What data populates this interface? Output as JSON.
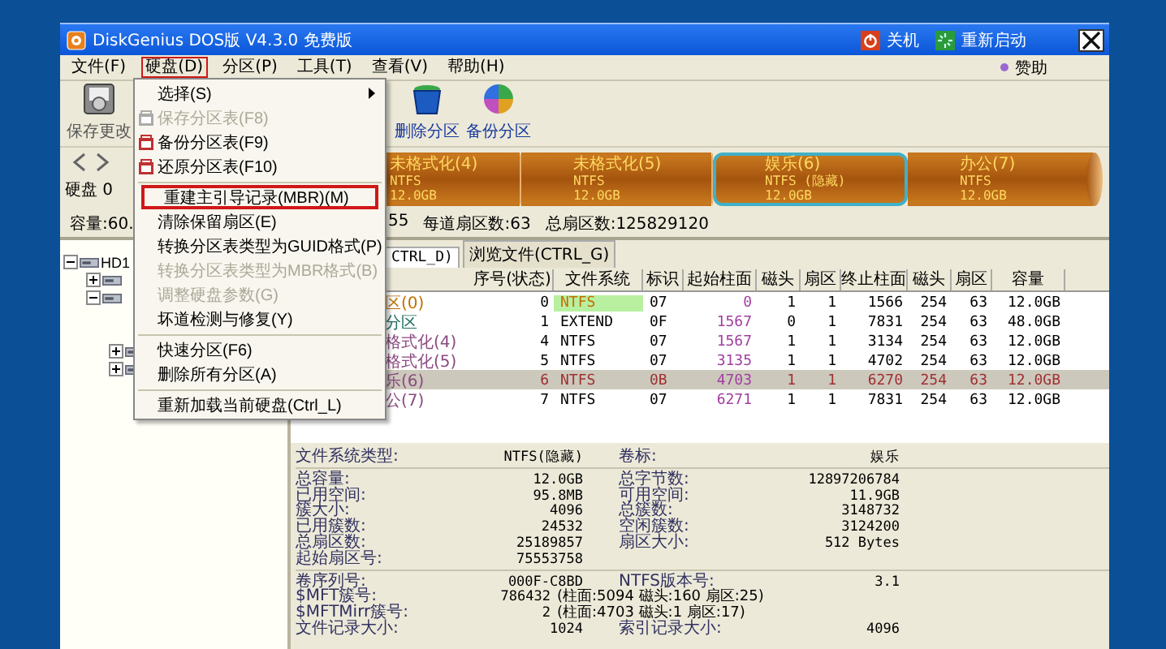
{
  "window": {
    "title": "DiskGenius DOS版 V4.3.0 免费版",
    "title_buttons": [
      {
        "kind": "shutdown",
        "label": "关机"
      },
      {
        "kind": "restart",
        "label": "重新启动"
      }
    ]
  },
  "menu_bar": {
    "items": [
      {
        "label": "文件(F)",
        "selected": false
      },
      {
        "label": "硬盘(D)",
        "selected": true
      },
      {
        "label": "分区(P)",
        "selected": false
      },
      {
        "label": "工具(T)",
        "selected": false
      },
      {
        "label": "查看(V)",
        "selected": false
      },
      {
        "label": "帮助(H)",
        "selected": false
      }
    ],
    "sponsor": "赞助"
  },
  "toolbar": {
    "buttons": [
      {
        "kind": "save",
        "label": "保存更改"
      },
      {
        "kind": "delete",
        "label": "删除分区"
      },
      {
        "kind": "backup",
        "label": "备份分区"
      }
    ]
  },
  "disk_nav": {
    "label": "硬盘 0"
  },
  "partition_bar": [
    {
      "name": "未格式化(4)",
      "fs": "NTFS",
      "size": "12.0GB",
      "selected": false
    },
    {
      "name": "未格式化(5)",
      "fs": "NTFS",
      "size": "12.0GB",
      "selected": false
    },
    {
      "name": "娱乐(6)",
      "fs": "NTFS (隐藏)",
      "size": "12.0GB",
      "selected": true
    },
    {
      "name": "办公(7)",
      "fs": "NTFS",
      "size": "12.0GB",
      "selected": false
    }
  ],
  "disk_info": {
    "left": "容量:60.",
    "parts": [
      "55",
      "每道扇区数:63",
      "总扇区数:125829120"
    ]
  },
  "tree": [
    {
      "label": "HD1",
      "expanded": true,
      "children": [
        {
          "expanded": false
        },
        {
          "expanded": true,
          "children": [
            {
              "expanded": false
            },
            {
              "expanded": false
            }
          ]
        }
      ]
    }
  ],
  "tabs": [
    {
      "label": "CTRL_D)",
      "selected": true
    },
    {
      "label": "浏览文件(CTRL_G)",
      "selected": false
    }
  ],
  "table": {
    "columns": [
      "序号(状态)",
      "文件系统",
      "标识",
      "起始柱面",
      "磁头",
      "扇区",
      "终止柱面",
      "磁头",
      "扇区",
      "容量"
    ],
    "rows": [
      {
        "name": "区(0)",
        "color": "#c07000",
        "active": true,
        "selected": false,
        "cells": [
          "0",
          "NTFS",
          "07",
          "0",
          "1",
          "1",
          "1566",
          "254",
          "63",
          "12.0GB"
        ]
      },
      {
        "name": "分区",
        "color": "#207060",
        "active": false,
        "selected": false,
        "cells": [
          "1",
          "EXTEND",
          "0F",
          "1567",
          "0",
          "1",
          "7831",
          "254",
          "63",
          "48.0GB"
        ]
      },
      {
        "name": "格式化(4)",
        "color": "#8a4a80",
        "active": false,
        "selected": false,
        "cells": [
          "4",
          "NTFS",
          "07",
          "1567",
          "1",
          "1",
          "3134",
          "254",
          "63",
          "12.0GB"
        ]
      },
      {
        "name": "格式化(5)",
        "color": "#8a4a80",
        "active": false,
        "selected": false,
        "cells": [
          "5",
          "NTFS",
          "07",
          "3135",
          "1",
          "1",
          "4702",
          "254",
          "63",
          "12.0GB"
        ]
      },
      {
        "name": "乐(6)",
        "color": "#8a4a80",
        "active": false,
        "selected": true,
        "cells": [
          "6",
          "NTFS",
          "0B",
          "4703",
          "1",
          "1",
          "6270",
          "254",
          "63",
          "12.0GB"
        ]
      },
      {
        "name": "公(7)",
        "color": "#8a4a80",
        "active": false,
        "selected": false,
        "cells": [
          "7",
          "NTFS",
          "07",
          "6271",
          "1",
          "1",
          "7831",
          "254",
          "63",
          "12.0GB"
        ]
      }
    ]
  },
  "details": [
    [
      {
        "label": "文件系统类型:",
        "value": "NTFS(隐藏)",
        "label2": "卷标:",
        "value2": "娱乐"
      }
    ],
    [
      {
        "label": "总容量:",
        "value": "12.0GB",
        "label2": "总字节数:",
        "value2": "12897206784"
      },
      {
        "label": "已用空间:",
        "value": "95.8MB",
        "label2": "可用空间:",
        "value2": "11.9GB"
      },
      {
        "label": "簇大小:",
        "value": "4096",
        "label2": "总簇数:",
        "value2": "3148732"
      },
      {
        "label": "已用簇数:",
        "value": "24532",
        "label2": "空闲簇数:",
        "value2": "3124200"
      },
      {
        "label": "总扇区数:",
        "value": "25189857",
        "label2": "扇区大小:",
        "value2": "512 Bytes"
      },
      {
        "label": "起始扇区号:",
        "value": "75553758"
      }
    ],
    [
      {
        "label": "卷序列号:",
        "value": "000F-C8BD",
        "label2": "NTFS版本号:",
        "value2": "3.1"
      },
      {
        "label": "$MFT簇号:",
        "value": "786432",
        "note": "(柱面:5094 磁头:160 扇区:25)"
      },
      {
        "label": "$MFTMirr簇号:",
        "value": "2",
        "note": "(柱面:4703 磁头:1 扇区:17)"
      },
      {
        "label": "文件记录大小:",
        "value": "1024",
        "label2": "索引记录大小:",
        "value2": "4096"
      }
    ]
  ],
  "dropdown": {
    "items": [
      {
        "kind": "item",
        "label": "选择(S)",
        "submenu": true,
        "icon": false,
        "disabled": false,
        "selected": false
      },
      {
        "kind": "item",
        "label": "保存分区表(F8)",
        "submenu": false,
        "icon": true,
        "disabled": true,
        "selected": false
      },
      {
        "kind": "item",
        "label": "备份分区表(F9)",
        "submenu": false,
        "icon": true,
        "disabled": false,
        "selected": false
      },
      {
        "kind": "item",
        "label": "还原分区表(F10)",
        "submenu": false,
        "icon": true,
        "disabled": false,
        "selected": false
      },
      {
        "kind": "separator"
      },
      {
        "kind": "item",
        "label": "重建主引导记录(MBR)(M)",
        "submenu": false,
        "icon": false,
        "disabled": false,
        "selected": true
      },
      {
        "kind": "item",
        "label": "清除保留扇区(E)",
        "submenu": false,
        "icon": false,
        "disabled": false,
        "selected": false
      },
      {
        "kind": "item",
        "label": "转换分区表类型为GUID格式(P)",
        "submenu": false,
        "icon": false,
        "disabled": false,
        "selected": false
      },
      {
        "kind": "item",
        "label": "转换分区表类型为MBR格式(B)",
        "submenu": false,
        "icon": false,
        "disabled": true,
        "selected": false
      },
      {
        "kind": "item",
        "label": "调整硬盘参数(G)",
        "submenu": false,
        "icon": false,
        "disabled": true,
        "selected": false
      },
      {
        "kind": "item",
        "label": "坏道检测与修复(Y)",
        "submenu": false,
        "icon": false,
        "disabled": false,
        "selected": false
      },
      {
        "kind": "separator"
      },
      {
        "kind": "item",
        "label": "快速分区(F6)",
        "submenu": false,
        "icon": false,
        "disabled": false,
        "selected": false
      },
      {
        "kind": "item",
        "label": "删除所有分区(A)",
        "submenu": false,
        "icon": false,
        "disabled": false,
        "selected": false
      },
      {
        "kind": "separator"
      },
      {
        "kind": "item",
        "label": "重新加载当前硬盘(Ctrl_L)",
        "submenu": false,
        "icon": false,
        "disabled": false,
        "selected": false
      }
    ]
  }
}
